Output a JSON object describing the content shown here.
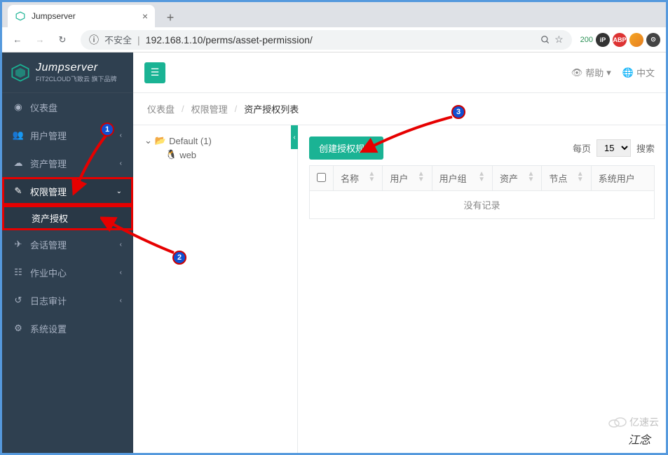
{
  "browser": {
    "tab_title": "Jumpserver",
    "url_warning": "不安全",
    "url": "192.168.1.10/perms/asset-permission/",
    "ext_count": "200"
  },
  "logo": {
    "title": "Jumpserver",
    "subtitle": "FIT2CLOUD飞致云 旗下品牌"
  },
  "sidebar": {
    "items": [
      {
        "label": "仪表盘"
      },
      {
        "label": "用户管理"
      },
      {
        "label": "资产管理"
      },
      {
        "label": "权限管理"
      },
      {
        "label": "会话管理"
      },
      {
        "label": "作业中心"
      },
      {
        "label": "日志审计"
      },
      {
        "label": "系统设置"
      }
    ],
    "sub_asset_auth": "资产授权"
  },
  "topbar": {
    "help": "帮助",
    "lang": "中文"
  },
  "breadcrumb": {
    "a": "仪表盘",
    "b": "权限管理",
    "c": "资产授权列表"
  },
  "tree": {
    "root": "Default (1)",
    "child": "web"
  },
  "toolbar": {
    "create": "创建授权规则",
    "per_page_label": "每页",
    "per_page_value": "15",
    "search_label": "搜索"
  },
  "table": {
    "headers": [
      "名称",
      "用户",
      "用户组",
      "资产",
      "节点",
      "系统用户"
    ],
    "empty": "没有记录"
  },
  "annotations": {
    "m1": "1",
    "m2": "2",
    "m3": "3"
  },
  "watermark": "亿速云",
  "watermark2": "江念"
}
